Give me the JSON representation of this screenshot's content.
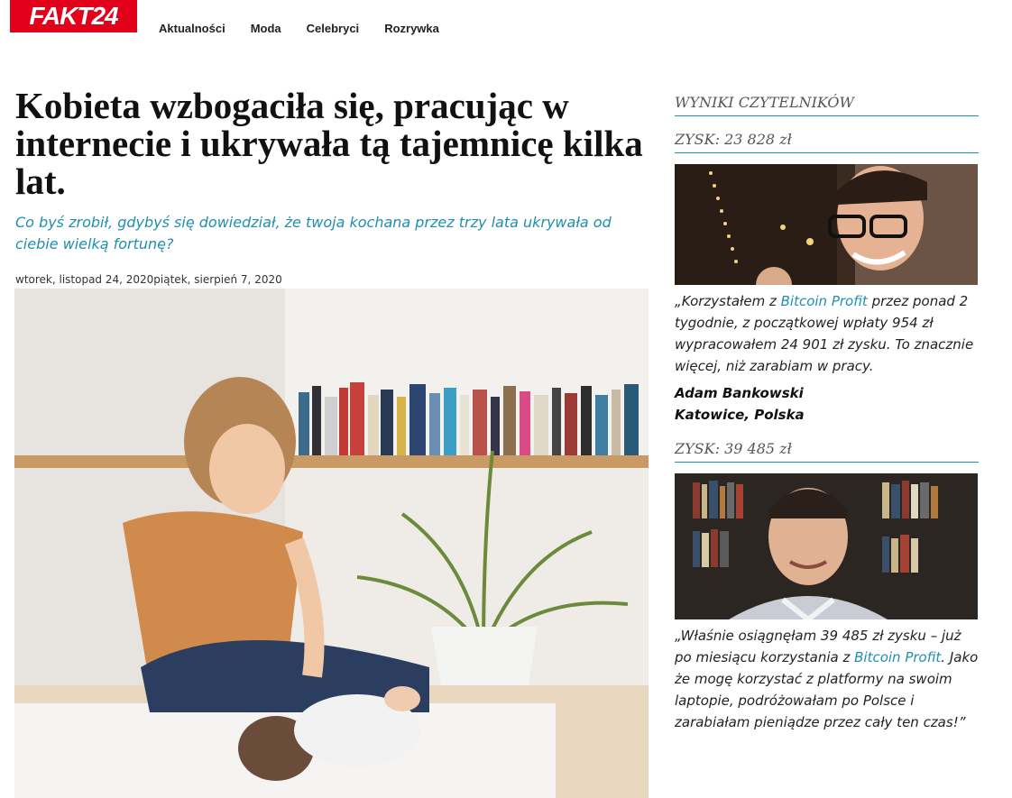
{
  "header": {
    "logo": "FAKT24",
    "nav": [
      "Aktualności",
      "Moda",
      "Celebryci",
      "Rozrywka"
    ]
  },
  "article": {
    "title": "Kobieta wzbogaciła się, pracując w internecie i ukrywała tą tajemnicę kilka lat.",
    "subtitle": "Co byś zrobił, gdybyś się dowiedział, że twoja kochana przez trzy lata ukrywała od ciebie wielką fortunę?",
    "date": "wtorek, listopad 24, 2020piątek, sierpień 7, 2020"
  },
  "sidebar": {
    "title": "WYNIKI CZYTELNIKÓW",
    "testimonials": [
      {
        "profit": "ZYSK: 23 828 zł",
        "quote_pre": "„Korzystałem z ",
        "link": "Bitcoin Profit",
        "quote_post": " przez ponad 2 tygodnie, z początkowej wpłaty 954 zł wypracowałem 24 901 zł zysku. To znacznie więcej, niż zarabiam w pracy.",
        "name": "Adam Bankowski",
        "location": "Katowice, Polska"
      },
      {
        "profit": "ZYSK: 39 485 zł",
        "quote_pre": "„Właśnie osiągnęłam 39 485 zł zysku – już po miesiącu korzystania z ",
        "link": "Bitcoin Profit",
        "quote_post": ". Jako że mogę korzystać z platformy na swoim laptopie, podróżowałam po Polsce i zarabiałam pieniądze przez cały ten czas!”"
      }
    ]
  },
  "colors": {
    "brand": "#e2001a",
    "accent": "#1f8fb0"
  }
}
